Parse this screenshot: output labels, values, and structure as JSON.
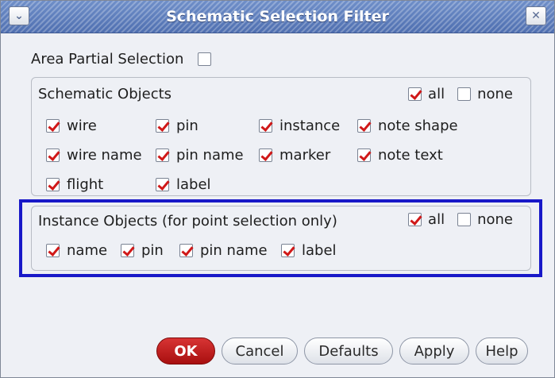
{
  "window": {
    "title": "Schematic Selection Filter"
  },
  "titlebar": {
    "menu_icon": "chevron-down-icon",
    "close_icon": "close-icon"
  },
  "area_partial": {
    "label": "Area Partial Selection",
    "checked": false
  },
  "schematic_objects": {
    "title": "Schematic Objects",
    "all_label": "all",
    "all_checked": true,
    "none_label": "none",
    "none_checked": false,
    "options": [
      {
        "label": "wire",
        "checked": true
      },
      {
        "label": "pin",
        "checked": true
      },
      {
        "label": "instance",
        "checked": true
      },
      {
        "label": "note shape",
        "checked": true
      },
      {
        "label": "wire name",
        "checked": true
      },
      {
        "label": "pin name",
        "checked": true
      },
      {
        "label": "marker",
        "checked": true
      },
      {
        "label": "note text",
        "checked": true
      },
      {
        "label": "flight",
        "checked": true
      },
      {
        "label": "label",
        "checked": true
      }
    ]
  },
  "instance_objects": {
    "title": "Instance Objects (for point selection only)",
    "all_label": "all",
    "all_checked": true,
    "none_label": "none",
    "none_checked": false,
    "options": [
      {
        "label": "name",
        "checked": true
      },
      {
        "label": "pin",
        "checked": true
      },
      {
        "label": "pin name",
        "checked": true
      },
      {
        "label": "label",
        "checked": true
      }
    ]
  },
  "buttons": {
    "ok": "OK",
    "cancel": "Cancel",
    "defaults": "Defaults",
    "apply": "Apply",
    "help": "Help"
  },
  "colors": {
    "check_mark": "#d01818",
    "highlight_box": "#1818c8",
    "title_bar": "#5a7bbd",
    "ok_button": "#c02020"
  }
}
